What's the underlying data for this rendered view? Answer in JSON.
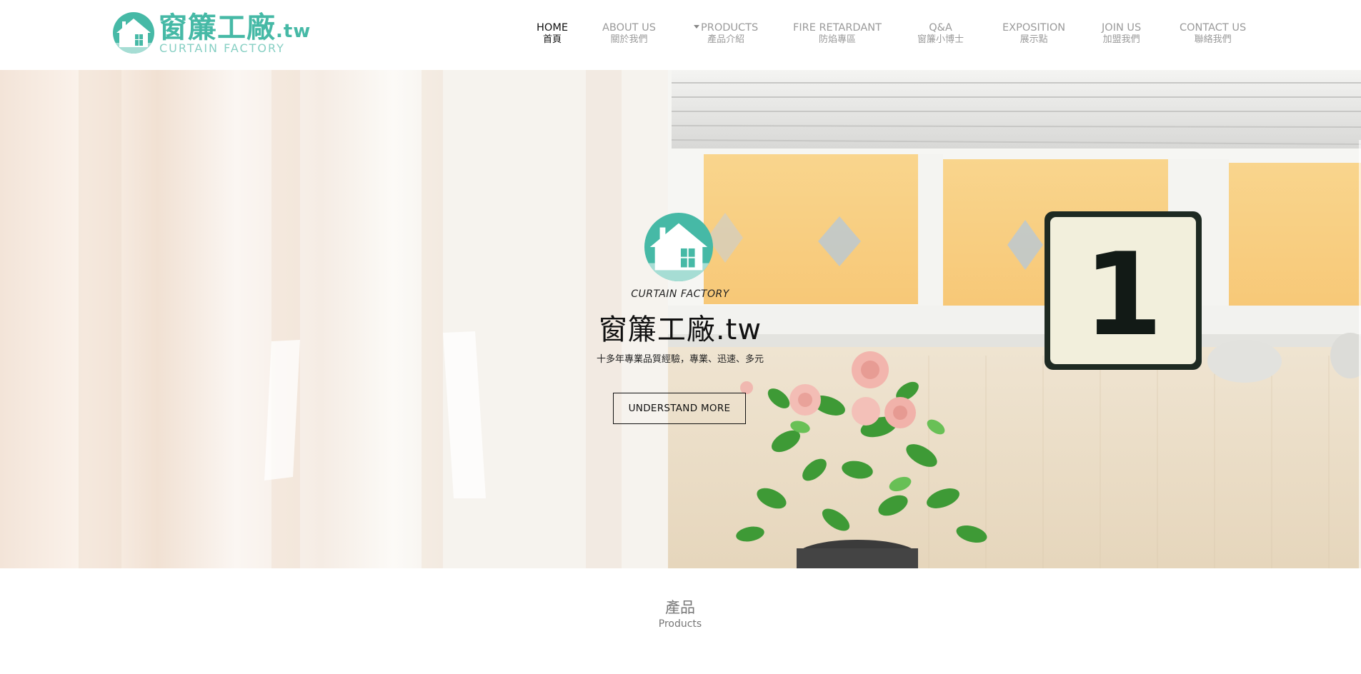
{
  "brand": {
    "name_cn": "窗簾工廠",
    "tld": ".tw",
    "name_en": "CURTAIN FACTORY",
    "accent": "#46b9a6",
    "accent_light": "#86cfc3"
  },
  "nav": [
    {
      "en": "HOME",
      "cn": "首頁",
      "active": true
    },
    {
      "en": "ABOUT US",
      "cn": "關於我們",
      "active": false
    },
    {
      "en": "PRODUCTS",
      "cn": "產品介紹",
      "active": false,
      "has_dropdown": true
    },
    {
      "en": "FIRE RETARDANT",
      "cn": "防焰專區",
      "active": false
    },
    {
      "en": "Q&A",
      "cn": "窗簾小博士",
      "active": false
    },
    {
      "en": "EXPOSITION",
      "cn": "展示點",
      "active": false
    },
    {
      "en": "JOIN US",
      "cn": "加盟我們",
      "active": false
    },
    {
      "en": "CONTACT US",
      "cn": "聯絡我們",
      "active": false
    }
  ],
  "hero": {
    "eyebrow": "CURTAIN FACTORY",
    "title": "窗簾工廠.tw",
    "subtitle": "十多年專業品質經驗，專業、迅速、多元",
    "cta_label": "UNDERSTAND MORE",
    "sign_number": "1"
  },
  "products_section": {
    "title_cn": "產品",
    "title_en": "Products"
  },
  "icons": {
    "logo": "house-logo-icon",
    "dropdown": "caret-down-icon"
  }
}
